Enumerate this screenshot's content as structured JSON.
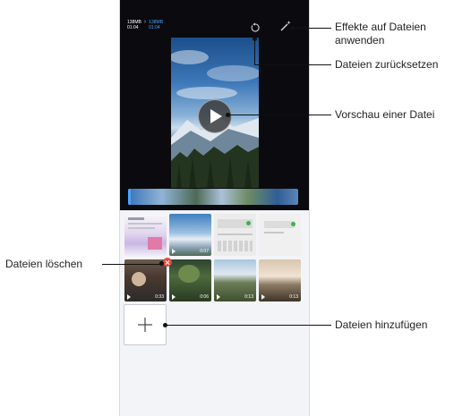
{
  "editor": {
    "size_original": "138MB",
    "time_original": "01:04",
    "size_new": "138MB",
    "time_new": "01:04",
    "save_label": "",
    "bottom_left_label": "",
    "bottom_right_label": ""
  },
  "thumbnails": [
    {
      "kind": "screenshot",
      "duration": ""
    },
    {
      "kind": "video",
      "duration": "0:07"
    },
    {
      "kind": "screenshot",
      "duration": ""
    },
    {
      "kind": "screenshot",
      "duration": ""
    },
    {
      "kind": "video",
      "duration": "0:33"
    },
    {
      "kind": "video",
      "duration": "0:06"
    },
    {
      "kind": "video",
      "duration": "0:13"
    },
    {
      "kind": "video",
      "duration": "0:13"
    }
  ],
  "callouts": {
    "effects": "Effekte auf Dateien\nanwenden",
    "effects_line1": "Effekte auf Dateien",
    "effects_line2": "anwenden",
    "reset": "Dateien zurücksetzen",
    "preview": "Vorschau einer Datei",
    "delete": "Dateien löschen",
    "add": "Dateien hinzufügen"
  },
  "icons": {
    "reset": "undo-icon",
    "effects": "magic-wand-icon",
    "play": "play-icon",
    "delete": "delete-badge-icon",
    "add": "plus-icon"
  },
  "colors": {
    "accent": "#4aa3ff",
    "delete": "#e24b3b",
    "editor_background": "#0b0b0f",
    "page_background": "#f3f4f7"
  }
}
